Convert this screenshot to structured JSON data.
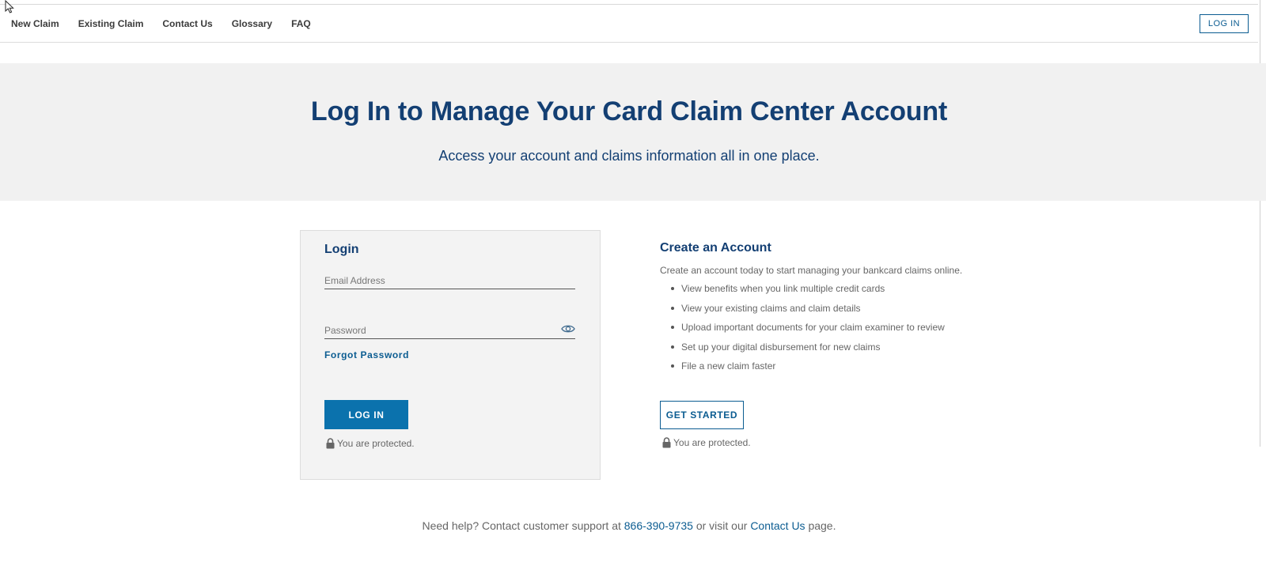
{
  "nav": {
    "links": [
      "New Claim",
      "Existing Claim",
      "Contact Us",
      "Glossary",
      "FAQ"
    ],
    "login_label": "LOG IN"
  },
  "hero": {
    "title": "Log In to Manage Your Card Claim Center Account",
    "subtitle": "Access your account and claims information all in one place."
  },
  "login": {
    "title": "Login",
    "email_placeholder": "Email Address",
    "password_placeholder": "Password",
    "forgot_label": "Forgot Password",
    "button_label": "LOG IN",
    "protected_text": "You are protected."
  },
  "create": {
    "title": "Create an Account",
    "intro": "Create an account today to start managing your bankcard claims online.",
    "bullets": [
      "View benefits when you link multiple credit cards",
      "View your existing claims and claim details",
      "Upload important documents for your claim examiner to review",
      "Set  up your digital disbursement for new claims",
      "File a new claim faster"
    ],
    "button_label": "GET STARTED",
    "protected_text": "You are protected."
  },
  "help": {
    "prefix": "Need help? Contact customer support at",
    "phone": "866-390-9735",
    "middle": "or visit our",
    "contact_link": "Contact Us",
    "suffix": "page."
  },
  "colors": {
    "brand_navy": "#133f73",
    "brand_blue": "#0b72ad",
    "link_blue": "#0b5c91",
    "hero_bg": "#f1f1f1"
  },
  "icons": {
    "password_toggle": "eye-icon",
    "protected": "lock-icon",
    "pointer": "mouse-cursor-icon"
  }
}
